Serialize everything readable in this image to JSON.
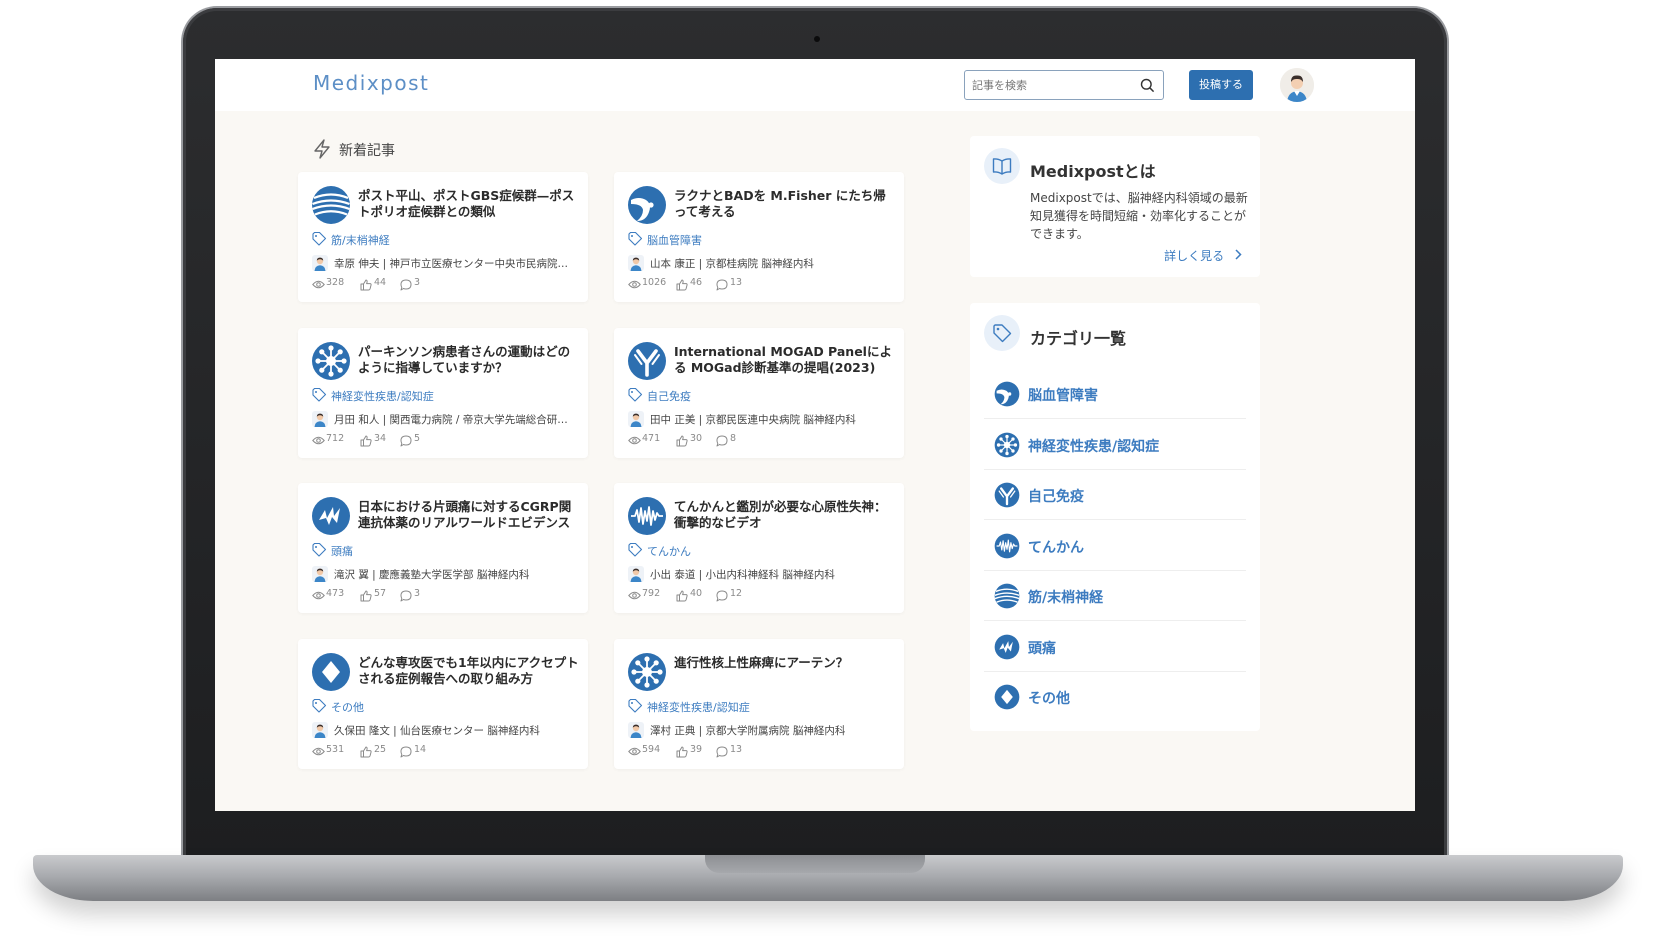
{
  "app": {
    "logo": "Medixpost",
    "search_placeholder": "記事を検索",
    "post_button": "投稿する"
  },
  "section": {
    "title": "新着記事"
  },
  "articles": [
    {
      "title": "ポスト平山、ポストGBS症候群—ポストポリオ症候群との類似",
      "category": "筋/末梢神経",
      "icon": "nerve-stripes-icon",
      "author": "幸原 伸夫 | 神戸市立医療センター中央市民病院…",
      "views": "328",
      "likes": "44",
      "comments": "3"
    },
    {
      "title": "ラクナとBADを M.Fisher にたち帰って考える",
      "category": "脳血管障害",
      "icon": "brain-vessel-icon",
      "author": "山本 康正 | 京都桂病院 脳神経内科",
      "views": "1026",
      "likes": "46",
      "comments": "13"
    },
    {
      "title": "パーキンソン病患者さんの運動はどのように指導していますか？",
      "category": "神経変性疾患/認知症",
      "icon": "neuron-icon",
      "author": "月田 和人 | 関西電力病院 / 帝京大学先端総合研…",
      "views": "712",
      "likes": "34",
      "comments": "5"
    },
    {
      "title": "International MOGAD Panelによる MOGad診断基準の提唱(2023)",
      "category": "自己免疫",
      "icon": "antibody-icon",
      "author": "田中 正美 | 京都民医連中央病院 脳神経内科",
      "views": "471",
      "likes": "30",
      "comments": "8"
    },
    {
      "title": "日本における片頭痛に対するCGRP関連抗体薬のリアルワールドエビデンス",
      "category": "頭痛",
      "icon": "headache-bolt-icon",
      "author": "滝沢 翼 | 慶應義塾大学医学部 脳神経内科",
      "views": "473",
      "likes": "57",
      "comments": "3"
    },
    {
      "title": "てんかんと鑑別が必要な心原性失神：衝撃的なビデオ",
      "category": "てんかん",
      "icon": "eeg-wave-icon",
      "author": "小出 泰道 | 小出内科神経科 脳神経内科",
      "views": "792",
      "likes": "40",
      "comments": "12"
    },
    {
      "title": "どんな専攻医でも1年以内にアクセプトされる症例報告への取り組み方",
      "category": "その他",
      "icon": "diamond-icon",
      "author": "久保田 隆文 | 仙台医療センター 脳神経内科",
      "views": "531",
      "likes": "25",
      "comments": "14"
    },
    {
      "title": "進行性核上性麻痺にアーテン？",
      "category": "神経変性疾患/認知症",
      "icon": "neuron-icon",
      "author": "澤村 正典 | 京都大学附属病院 脳神経内科",
      "views": "594",
      "likes": "39",
      "comments": "13"
    }
  ],
  "about": {
    "title": "Medixpostとは",
    "body": "Medixpostでは、脳神経内科領域の最新知見獲得を時間短縮・効率化することができます。",
    "more": "詳しく見る"
  },
  "categories": {
    "title": "カテゴリ一覧",
    "items": [
      {
        "label": "脳血管障害",
        "icon": "brain-vessel-icon"
      },
      {
        "label": "神経変性疾患/認知症",
        "icon": "neuron-icon"
      },
      {
        "label": "自己免疫",
        "icon": "antibody-icon"
      },
      {
        "label": "てんかん",
        "icon": "eeg-wave-icon"
      },
      {
        "label": "筋/末梢神経",
        "icon": "nerve-stripes-icon"
      },
      {
        "label": "頭痛",
        "icon": "headache-bolt-icon"
      },
      {
        "label": "その他",
        "icon": "diamond-icon"
      }
    ]
  },
  "colors": {
    "accent": "#2d6fb0",
    "link": "#3d7cc0",
    "background": "#faf8f4"
  }
}
